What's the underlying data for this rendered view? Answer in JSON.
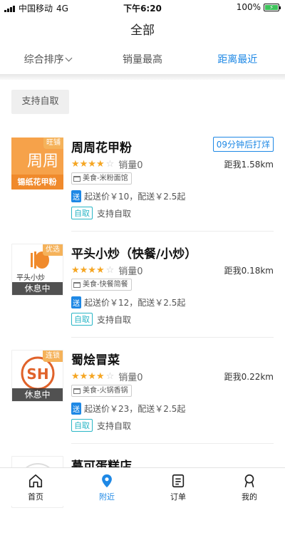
{
  "status": {
    "carrier": "中国移动",
    "network": "4G",
    "time": "下午6:20",
    "battery": "100%"
  },
  "header": {
    "title": "全部"
  },
  "sort_tabs": [
    {
      "label": "综合排序",
      "active": false,
      "has_dropdown": true
    },
    {
      "label": "销量最高",
      "active": false
    },
    {
      "label": "距离最近",
      "active": true
    }
  ],
  "filter": {
    "label": "支持自取"
  },
  "stores": [
    {
      "name": "周周花甲粉",
      "logo_tag": "旺铺",
      "logo_text": "周周",
      "logo_sub": "锡纸花甲粉",
      "closed_label": "",
      "time_badge": "09分钟后打烊",
      "rating": 4,
      "sales": "销量0",
      "distance": "距我1.58km",
      "category": "美食-米粉面馆",
      "delivery_badge": "送",
      "delivery": "起送价￥10，配送￥2.5起",
      "pickup_badge": "自取",
      "pickup": "支持自取"
    },
    {
      "name": "平头小炒（快餐/小炒）",
      "logo_tag": "优选",
      "logo_text": "平头小炒",
      "closed_label": "休息中",
      "time_badge": "",
      "rating": 4,
      "sales": "销量0",
      "distance": "距我0.18km",
      "category": "美食-快餐简餐",
      "delivery_badge": "送",
      "delivery": "起送价￥12，配送￥2.5起",
      "pickup_badge": "自取",
      "pickup": "支持自取"
    },
    {
      "name": "蜀烩冒菜",
      "logo_tag": "连锁",
      "logo_text": "SH",
      "closed_label": "休息中",
      "time_badge": "",
      "rating": 4,
      "sales": "销量0",
      "distance": "距我0.22km",
      "category": "美食-火锅香锅",
      "delivery_badge": "送",
      "delivery": "起送价￥23，配送￥2.5起",
      "pickup_badge": "自取",
      "pickup": "支持自取"
    },
    {
      "name": "慕可蛋糕店"
    }
  ],
  "tabbar": [
    {
      "label": "首页",
      "icon": "home-icon"
    },
    {
      "label": "附近",
      "icon": "location-pin-icon",
      "active": true
    },
    {
      "label": "订单",
      "icon": "order-list-icon"
    },
    {
      "label": "我的",
      "icon": "user-icon"
    }
  ],
  "colors": {
    "accent": "#1e88e5",
    "star": "#f5a623",
    "logo_orange": "#f08a2c",
    "pickup": "#29b6c6"
  }
}
